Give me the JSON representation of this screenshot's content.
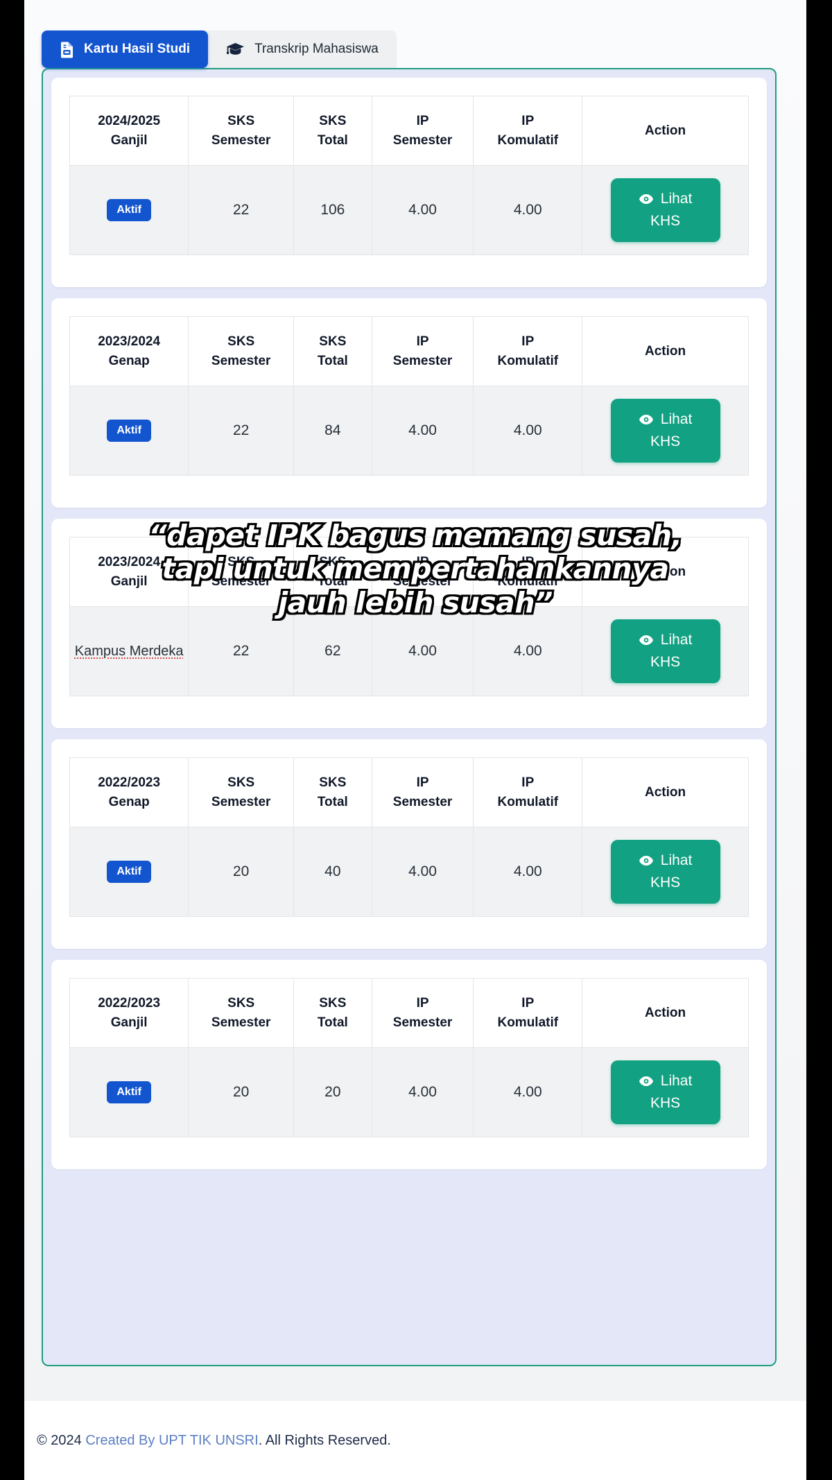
{
  "tabs": [
    {
      "label": "Kartu Hasil Studi",
      "icon": "document-icon",
      "active": true
    },
    {
      "label": "Transkrip Mahasiswa",
      "icon": "graduation-cap-icon",
      "active": false
    }
  ],
  "columns": {
    "period": "",
    "sks_semester_l1": "SKS",
    "sks_semester_l2": "Semester",
    "sks_total_l1": "SKS",
    "sks_total_l2": "Total",
    "ip_semester_l1": "IP",
    "ip_semester_l2": "Semester",
    "ip_komulatif_l1": "IP",
    "ip_komulatif_l2": "Komulatif",
    "action": "Action"
  },
  "action_button": {
    "label_line1": "Lihat",
    "label_line2": "KHS",
    "icon": "eye-icon",
    "color": "#12a182"
  },
  "badge": {
    "aktif": "Aktif",
    "color": "#1355cf"
  },
  "semesters": [
    {
      "year": "2024/2025",
      "term": "Ganjil",
      "status": "Aktif",
      "status_type": "badge",
      "sks_semester": "22",
      "sks_total": "106",
      "ip_semester": "4.00",
      "ip_komulatif": "4.00"
    },
    {
      "year": "2023/2024",
      "term": "Genap",
      "status": "Aktif",
      "status_type": "badge",
      "sks_semester": "22",
      "sks_total": "84",
      "ip_semester": "4.00",
      "ip_komulatif": "4.00"
    },
    {
      "year": "2023/2024",
      "term": "Ganjil",
      "status": "Kampus Merdeka",
      "status_type": "text",
      "sks_semester": "22",
      "sks_total": "62",
      "ip_semester": "4.00",
      "ip_komulatif": "4.00"
    },
    {
      "year": "2022/2023",
      "term": "Genap",
      "status": "Aktif",
      "status_type": "badge",
      "sks_semester": "20",
      "sks_total": "40",
      "ip_semester": "4.00",
      "ip_komulatif": "4.00"
    },
    {
      "year": "2022/2023",
      "term": "Ganjil",
      "status": "Aktif",
      "status_type": "badge",
      "sks_semester": "20",
      "sks_total": "20",
      "ip_semester": "4.00",
      "ip_komulatif": "4.00"
    }
  ],
  "caption": {
    "line1": "“dapet IPK bagus memang susah,",
    "line2": "tapi untuk mempertahankannya",
    "line3": "jauh lebih susah”"
  },
  "footer": {
    "prefix": "© 2024 ",
    "link": "Created By UPT TIK UNSRI",
    "suffix": ". All Rights Reserved."
  },
  "theme": {
    "panel_border": "#1f9c7f",
    "panel_bg": "#e3e7f8",
    "accent_blue": "#1355cf",
    "accent_teal": "#12a182"
  }
}
